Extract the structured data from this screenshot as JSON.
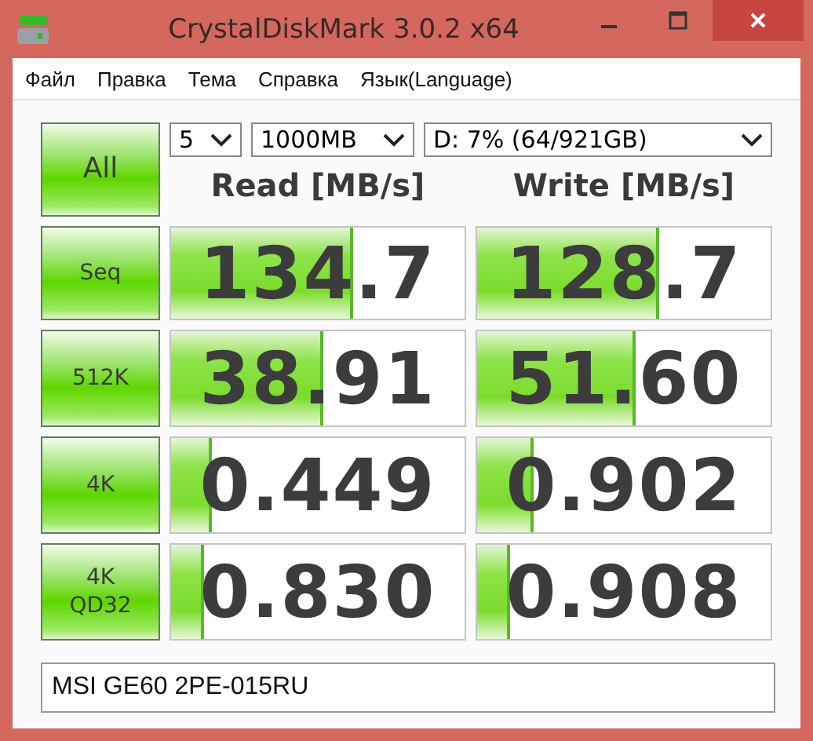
{
  "window": {
    "title": "CrystalDiskMark 3.0.2 x64"
  },
  "menu": [
    "Файл",
    "Правка",
    "Тема",
    "Справка",
    "Язык(Language)"
  ],
  "all_button": "All",
  "selectors": [
    {
      "value": "5"
    },
    {
      "value": "1000MB"
    },
    {
      "value": "D: 7% (64/921GB)"
    }
  ],
  "columns": [
    "Read [MB/s]",
    "Write [MB/s]"
  ],
  "rows": [
    {
      "label": "Seq",
      "read": {
        "value": "134.7",
        "level": 0.61
      },
      "write": {
        "value": "128.7",
        "level": 0.61
      }
    },
    {
      "label": "512K",
      "read": {
        "value": "38.91",
        "level": 0.51
      },
      "write": {
        "value": "51.60",
        "level": 0.53
      }
    },
    {
      "label": "4K",
      "read": {
        "value": "0.449",
        "level": 0.13
      },
      "write": {
        "value": "0.902",
        "level": 0.18
      }
    },
    {
      "label": "4K\nQD32",
      "read": {
        "value": "0.830",
        "level": 0.1
      },
      "write": {
        "value": "0.908",
        "level": 0.1
      }
    }
  ],
  "comment": "MSI GE60 2PE-015RU"
}
